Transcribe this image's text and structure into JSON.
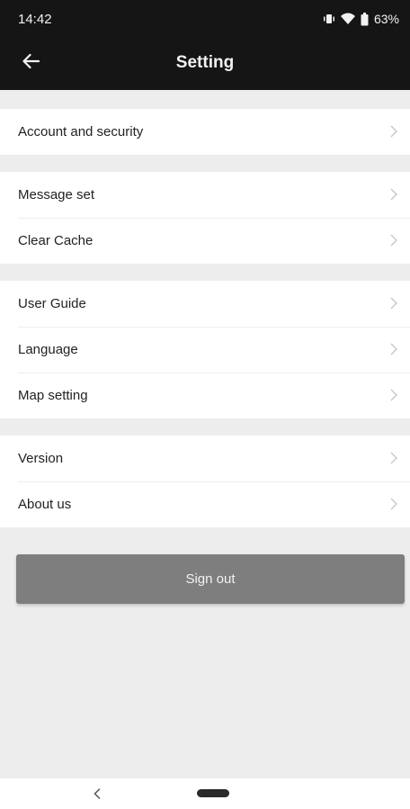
{
  "status_bar": {
    "time": "14:42",
    "battery": "63%",
    "icons": [
      "vibrate-icon",
      "wifi-icon",
      "battery-icon"
    ]
  },
  "header": {
    "title": "Setting",
    "back_icon": "arrow-left-icon"
  },
  "groups": [
    {
      "items": [
        {
          "label": "Account and security"
        }
      ]
    },
    {
      "items": [
        {
          "label": "Message set"
        },
        {
          "label": "Clear Cache"
        }
      ]
    },
    {
      "items": [
        {
          "label": "User Guide"
        },
        {
          "label": "Language"
        },
        {
          "label": "Map setting"
        }
      ]
    },
    {
      "items": [
        {
          "label": "Version"
        },
        {
          "label": "About us"
        }
      ]
    }
  ],
  "sign_out_label": "Sign out",
  "colors": {
    "header_bg": "#151515",
    "page_bg": "#ededed",
    "row_bg": "#ffffff",
    "button_bg": "#7e7e7e"
  }
}
